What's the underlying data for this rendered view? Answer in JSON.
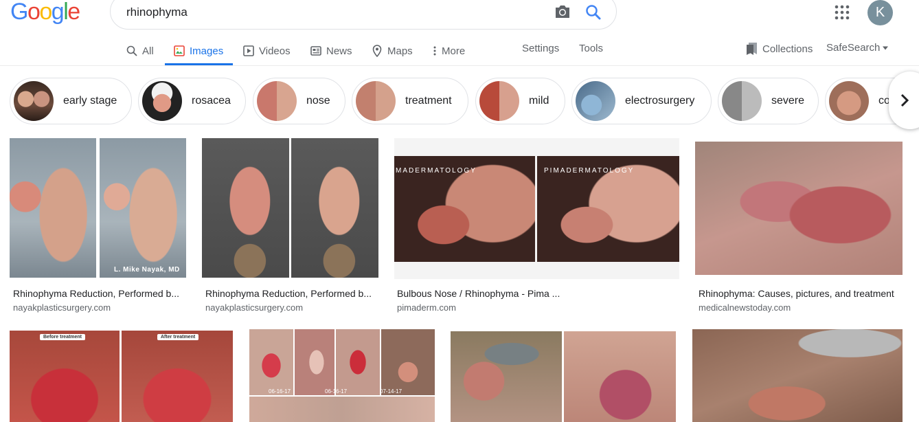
{
  "header": {
    "logo_letters": [
      "G",
      "o",
      "o",
      "g",
      "l",
      "e"
    ],
    "search_value": "rhinophyma",
    "avatar_letter": "K"
  },
  "tabs": [
    {
      "label": "All",
      "icon": "search-icon"
    },
    {
      "label": "Images",
      "icon": "image-icon",
      "active": true
    },
    {
      "label": "Videos",
      "icon": "play-icon"
    },
    {
      "label": "News",
      "icon": "news-icon"
    },
    {
      "label": "Maps",
      "icon": "map-pin-icon"
    },
    {
      "label": "More",
      "icon": "more-vertical-icon"
    }
  ],
  "tools": {
    "settings": "Settings",
    "tools": "Tools",
    "collections": "Collections",
    "safesearch": "SafeSearch"
  },
  "chips": [
    {
      "label": "early stage"
    },
    {
      "label": "rosacea"
    },
    {
      "label": "nose"
    },
    {
      "label": "treatment"
    },
    {
      "label": "mild"
    },
    {
      "label": "electrosurgery"
    },
    {
      "label": "severe"
    },
    {
      "label": "co"
    }
  ],
  "results": [
    {
      "title": "Rhinophyma Reduction, Performed b...",
      "source": "nayakplasticsurgery.com",
      "overlay": "L. Mike Nayak, MD"
    },
    {
      "title": "Rhinophyma Reduction, Performed b...",
      "source": "nayakplasticsurgery.com"
    },
    {
      "title": "Bulbous Nose / Rhinophyma - Pima ...",
      "source": "pimaderm.com",
      "overlay_left": "MADERMATOLOGY",
      "overlay_right": "PIMADERMATOLOGY"
    },
    {
      "title": "Rhinophyma: Causes, pictures, and treatment",
      "source": "medicalnewstoday.com"
    },
    {
      "tag_before": "Before treatment",
      "tag_after": "After treatment"
    },
    {
      "date_1": "06-16-17",
      "date_2": "06-16-17",
      "date_3": "07-14-17"
    },
    {},
    {}
  ],
  "colors": {
    "accent": "#1a73e8",
    "logo_blue": "#4285f4",
    "logo_red": "#ea4335",
    "logo_yellow": "#fbbc05",
    "logo_green": "#34a853"
  }
}
